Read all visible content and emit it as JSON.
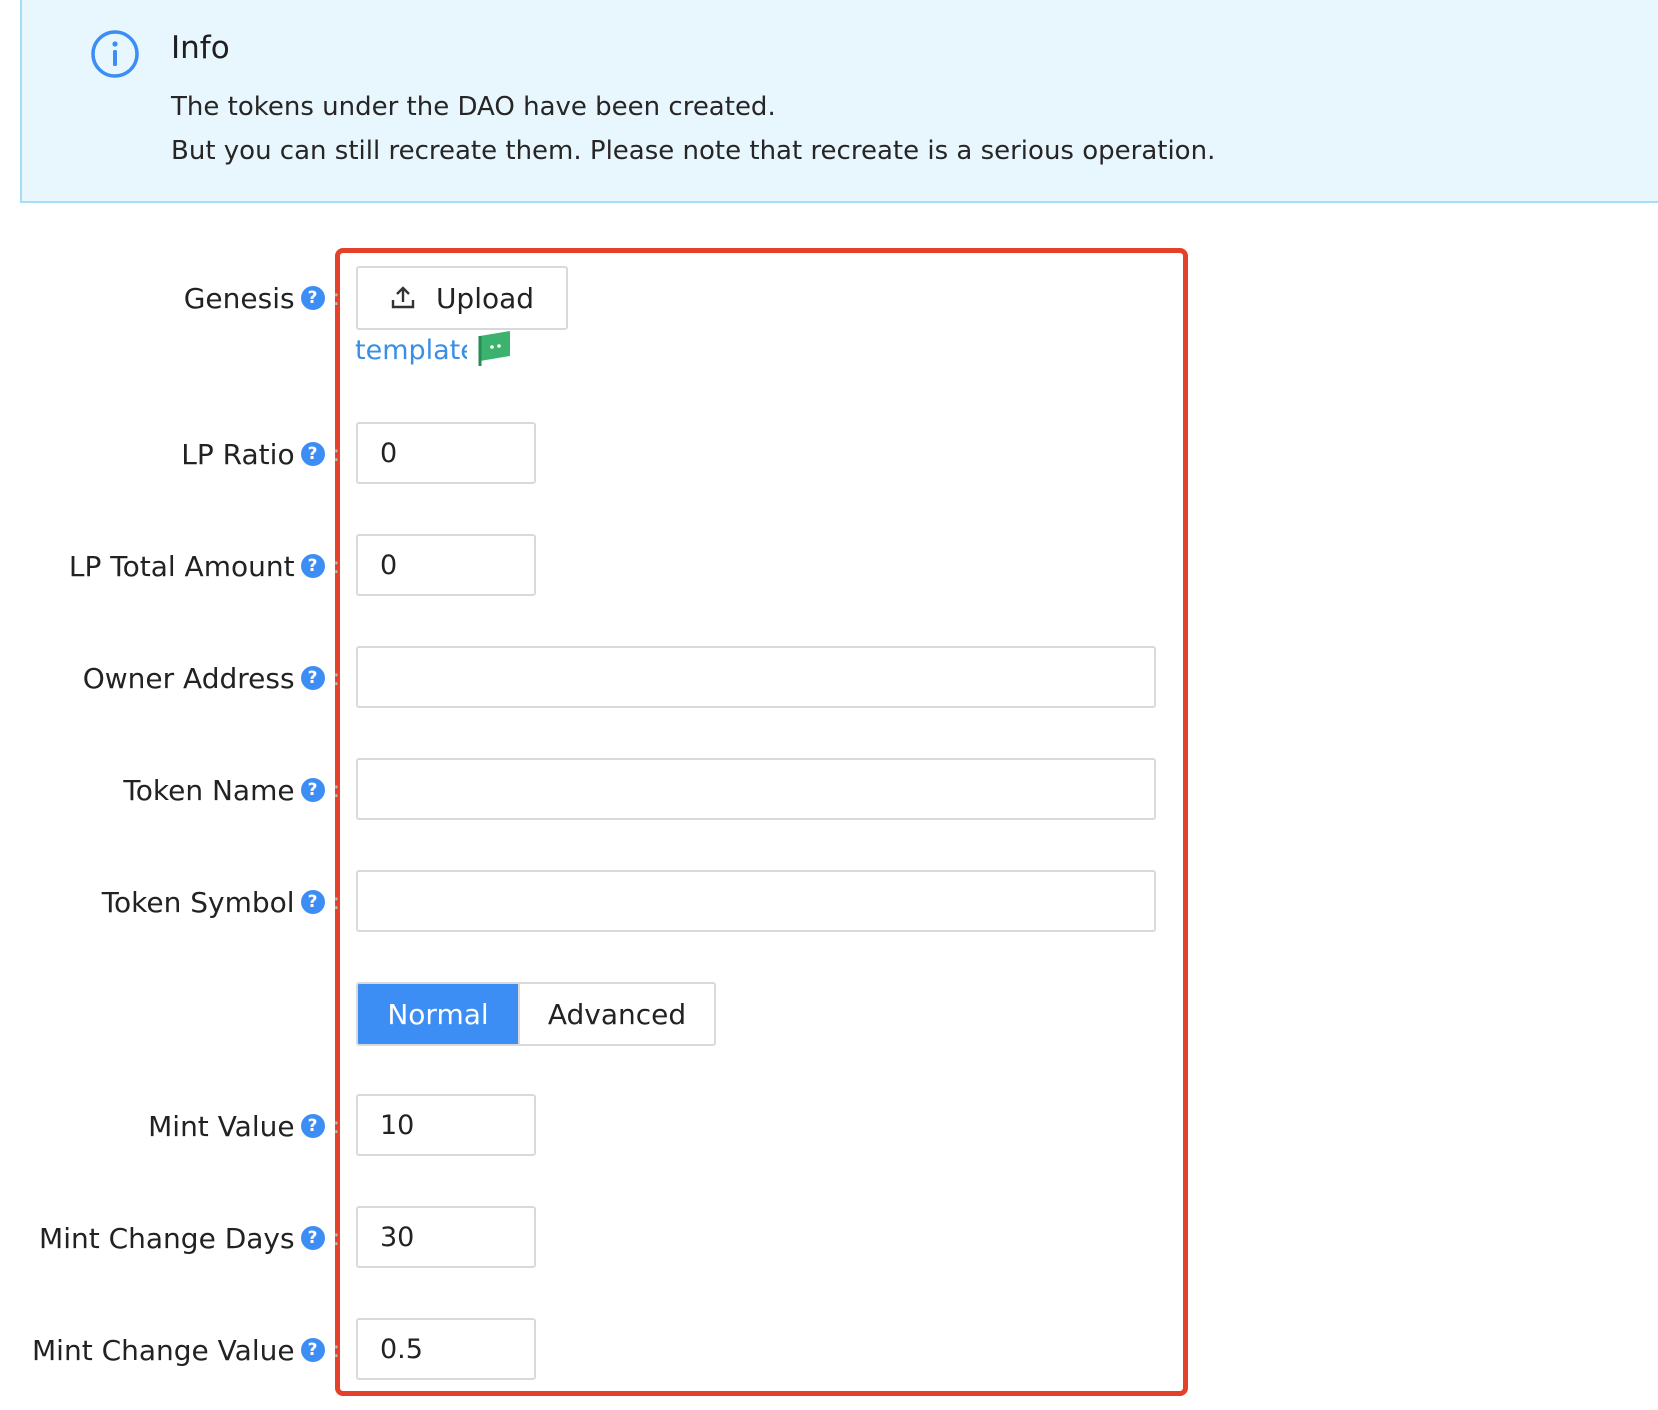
{
  "alert": {
    "title": "Info",
    "line1": "The tokens under the DAO have been created.",
    "line2": "But you can still recreate them. Please note that recreate is a serious operation.",
    "icon": "info-circle-icon"
  },
  "form": {
    "genesis": {
      "label": "Genesis",
      "upload_label": "Upload",
      "template_link": "template"
    },
    "lp_ratio": {
      "label": "LP Ratio",
      "value": "0"
    },
    "lp_total_amount": {
      "label": "LP Total Amount",
      "value": "0"
    },
    "owner_address": {
      "label": "Owner Address",
      "value": ""
    },
    "token_name": {
      "label": "Token Name",
      "value": ""
    },
    "token_symbol": {
      "label": "Token Symbol",
      "value": ""
    },
    "mode": {
      "normal": "Normal",
      "advanced": "Advanced",
      "selected": "Normal"
    },
    "mint_value": {
      "label": "Mint Value",
      "value": "10"
    },
    "mint_change_days": {
      "label": "Mint Change Days",
      "value": "30"
    },
    "mint_change_value": {
      "label": "Mint Change Value",
      "value": "0.5"
    }
  },
  "colors": {
    "accent": "#3c8ef5",
    "highlight": "#e5402a",
    "alert_bg": "#e8f6fd"
  }
}
